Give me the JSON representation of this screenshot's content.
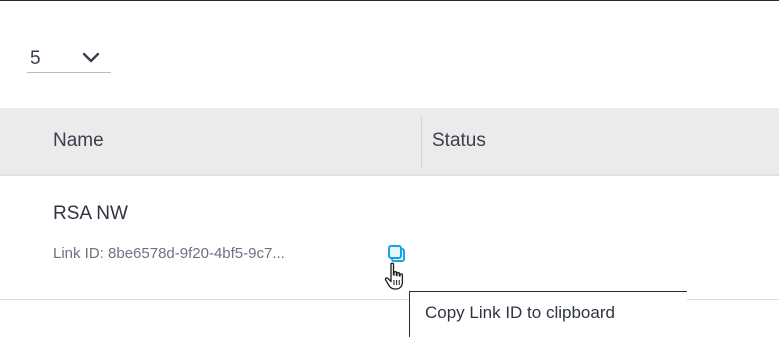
{
  "pagination": {
    "page_size_value": "5"
  },
  "table": {
    "columns": [
      "Name",
      "Status"
    ],
    "rows": [
      {
        "name": "RSA NW",
        "link_id": "Link ID: 8be6578d-9f20-4bf5-9c7...",
        "status": ""
      }
    ]
  },
  "tooltip": {
    "text": "Copy Link ID to clipboard"
  },
  "colors": {
    "copy_icon_accent": "#1ba1e2",
    "header_background": "#ebebeb"
  },
  "icons": {
    "page_size_dropdown": "chevron-down-icon",
    "copy": "copy-icon",
    "cursor": "hand-pointer-cursor"
  }
}
